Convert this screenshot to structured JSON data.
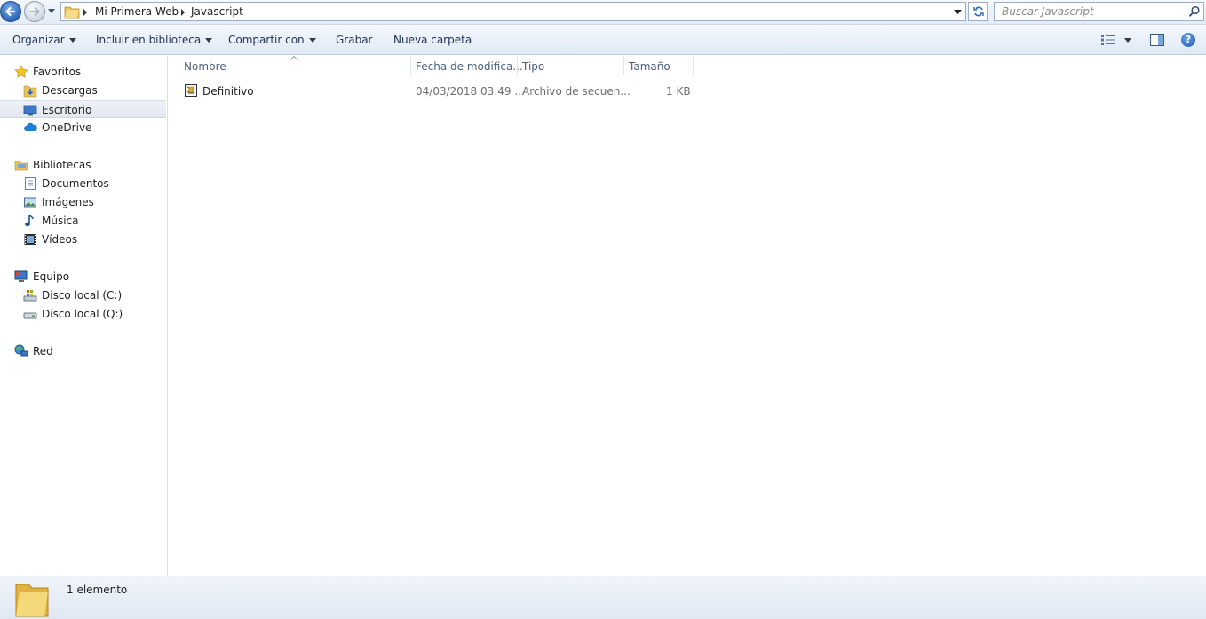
{
  "address": {
    "crumbs": [
      "Mi Primera Web",
      "Javascript"
    ],
    "search_placeholder": "Buscar Javascript"
  },
  "toolbar": {
    "organize": "Organizar",
    "include_library": "Incluir en biblioteca",
    "share_with": "Compartir con",
    "burn": "Grabar",
    "new_folder": "Nueva carpeta"
  },
  "sidebar": {
    "favorites": {
      "title": "Favoritos",
      "items": [
        "Descargas",
        "Escritorio",
        "OneDrive"
      ],
      "selected": "Escritorio"
    },
    "libraries": {
      "title": "Bibliotecas",
      "items": [
        "Documentos",
        "Imágenes",
        "Música",
        "Vídeos"
      ]
    },
    "computer": {
      "title": "Equipo",
      "items": [
        "Disco local (C:)",
        "Disco local (Q:)"
      ]
    },
    "network": {
      "title": "Red"
    }
  },
  "files": {
    "columns": [
      "Nombre",
      "Fecha de modifica...",
      "Tipo",
      "Tamaño"
    ],
    "rows": [
      {
        "name": "Definitivo",
        "date": "04/03/2018 03:49 ...",
        "type": "Archivo de secuen...",
        "size": "1 KB"
      }
    ]
  },
  "status": {
    "count": "1 elemento"
  },
  "colors": {
    "accent": "#2a66b8",
    "header_text": "#4c607a",
    "muted_text": "#6d6d6d"
  }
}
